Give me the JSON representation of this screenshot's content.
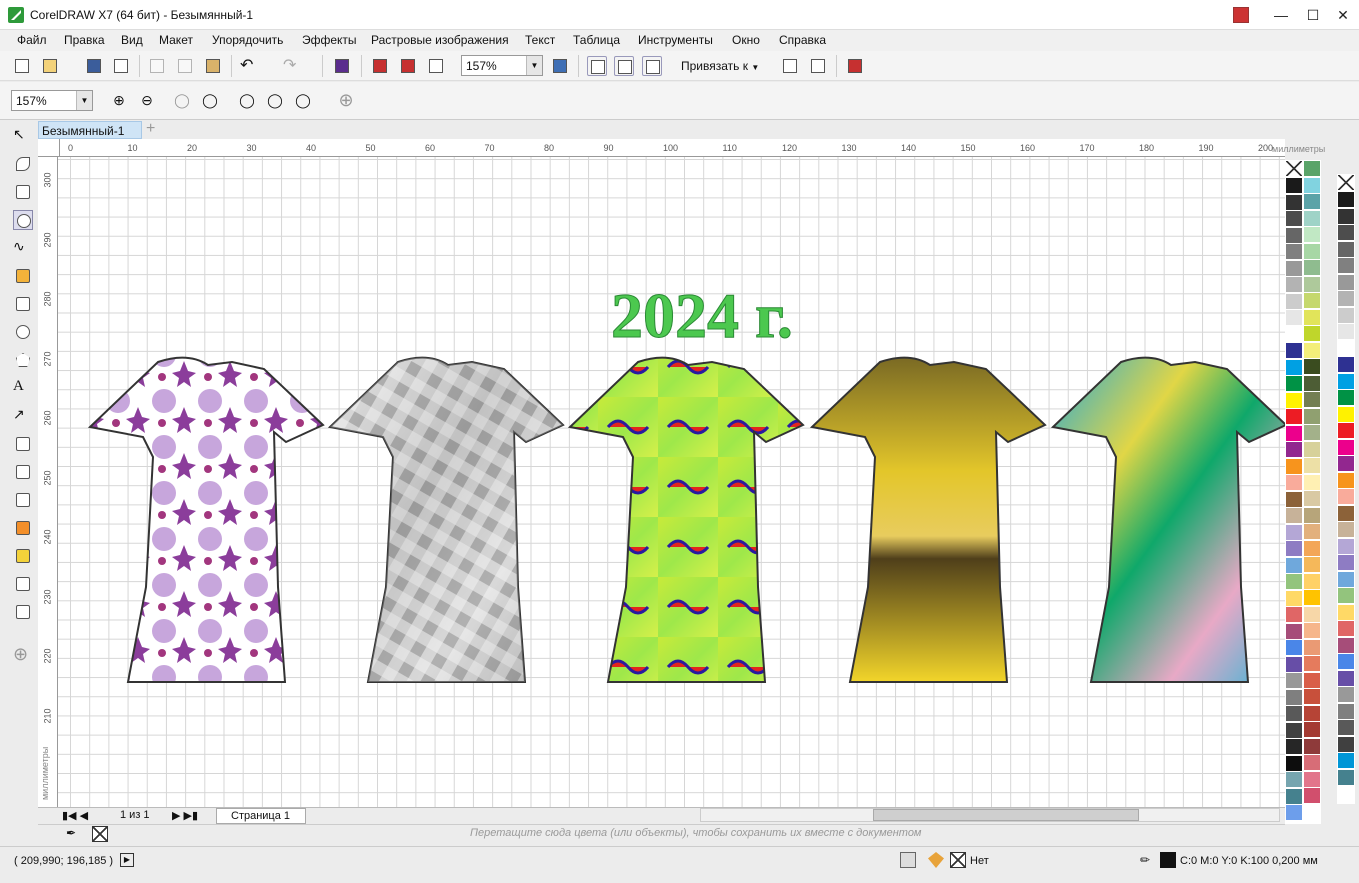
{
  "window": {
    "title": "CorelDRAW X7 (64 бит) - Безымянный-1",
    "min_icon": "minimize-icon",
    "max_icon": "maximize-icon",
    "close_icon": "close-icon"
  },
  "menu": [
    "Файл",
    "Правка",
    "Вид",
    "Макет",
    "Упорядочить",
    "Эффекты",
    "Растровые изображения",
    "Текст",
    "Таблица",
    "Инструменты",
    "Окно",
    "Справка"
  ],
  "toolbar": {
    "zoom_value": "157%",
    "snap_label": "Привязать к",
    "snap_arrow": "▼"
  },
  "toolbar2": {
    "zoom_value": "157%"
  },
  "doc": {
    "tab_label": "Безымянный-1",
    "tab_add": "+",
    "units": "миллиметры"
  },
  "rulers": {
    "h_ticks": [
      "0",
      "10",
      "20",
      "30",
      "40",
      "50",
      "60",
      "70",
      "80",
      "90",
      "100",
      "110",
      "120",
      "130",
      "140",
      "150",
      "160",
      "170",
      "180",
      "190",
      "200"
    ],
    "v_ticks": [
      "300",
      "290",
      "280",
      "270",
      "260",
      "250",
      "240",
      "230",
      "220",
      "210"
    ],
    "v_unit": "миллиметры"
  },
  "canvas": {
    "headline": "2024 г.",
    "headline_color": "#4cc84f",
    "dresses": [
      {
        "name": "dress-1",
        "style": "purple-star-print",
        "base": "#ffffff",
        "accent": "#8b3d9b"
      },
      {
        "name": "dress-2",
        "style": "grey-argyle",
        "base": "#cfcfcf",
        "accent": "#555555"
      },
      {
        "name": "dress-3",
        "style": "green-fractal",
        "base": "#c8ea3a",
        "accent": "#e2261d"
      },
      {
        "name": "dress-4",
        "style": "yellow-gradient",
        "base": "#e2c72a",
        "accent": "#6b5a20"
      },
      {
        "name": "dress-5",
        "style": "pastel-watercolor",
        "base": "#27a9d6",
        "accent": "#e1d646"
      }
    ]
  },
  "pager": {
    "count": "1 из 1",
    "page_tab": "Страница 1"
  },
  "dropzone": {
    "text": "Перетащите сюда цвета (или объекты), чтобы сохранить их вместе с документом"
  },
  "status": {
    "coords": "( 209,990; 196,185 )",
    "fill": "Нет",
    "outline": "C:0 M:0 Y:0 K:100  0,200 мм"
  },
  "palette": {
    "col1": [
      "#1a1a1a",
      "#333333",
      "#4d4d4d",
      "#666666",
      "#808080",
      "#999999",
      "#b3b3b3",
      "#cccccc",
      "#e6e6e6",
      "#ffffff",
      "#2e3192",
      "#00a0e3",
      "#009245",
      "#fff200",
      "#ed1c24",
      "#ec008c",
      "#92278f",
      "#f7941d",
      "#f9ab9b",
      "#8c6239",
      "#c7b299",
      "#b4a7d6",
      "#8e7cc3",
      "#6fa8dc",
      "#93c47d",
      "#ffd966",
      "#e06666",
      "#a64d79",
      "#4a86e8",
      "#674ea7",
      "#999999",
      "#7f7f7f",
      "#595959",
      "#404040",
      "#262626",
      "#0d0d0d",
      "#76a5af",
      "#45818e",
      "#6d9eeb",
      "#c27ba0"
    ],
    "col2": [
      "#5aa469",
      "#81d3e0",
      "#5ba3a8",
      "#9fd3c7",
      "#c1e8c4",
      "#a7d7a5",
      "#8fbc8f",
      "#aec99b",
      "#c5d86d",
      "#e1e45a",
      "#bfd62b",
      "#f3ee7a",
      "#3a4c1f",
      "#4d5d35",
      "#737f52",
      "#90a070",
      "#a3b18a",
      "#d7d19a",
      "#ede0a6",
      "#fff0b3",
      "#d9c9a3",
      "#b7a57a",
      "#e2b07d",
      "#f3a658",
      "#f5b85a",
      "#ffd166",
      "#ffc300",
      "#f7d7a8",
      "#f6b68b",
      "#ea9a74",
      "#e57b5d",
      "#d95e49",
      "#c8503b",
      "#b64436",
      "#a43a32",
      "#8e3a3a",
      "#d76d77",
      "#e2758b",
      "#d14f6d",
      "#e5163d"
    ],
    "col3": [
      "#ff6f61",
      "#f08a8a",
      "#e69aa6",
      "#d8a0b5",
      "#c68db0",
      "#b55d99",
      "#a34383",
      "#d99ac5",
      "#e7b3d6",
      "#f1c7e3",
      "#b068a8",
      "#a0529c",
      "#8e3d92",
      "#7b2f86",
      "#663399",
      "#59337a",
      "#4a2c6b",
      "#3b2559",
      "#2e1f48",
      "#21183a",
      "#c59be0",
      "#b27fd1",
      "#9c64bf",
      "#8549ac",
      "#6f3198",
      "#000000",
      "#7a7a7a",
      "#ffffff"
    ],
    "col4": [
      "#1a1a1a",
      "#333333",
      "#4d4d4d",
      "#666666",
      "#808080",
      "#999999",
      "#b3b3b3",
      "#cccccc",
      "#e6e6e6",
      "#ffffff",
      "#2e3192",
      "#00a0e3",
      "#009245",
      "#fff200",
      "#ed1c24",
      "#ec008c",
      "#92278f",
      "#f7941d",
      "#f9ab9b",
      "#8c6239",
      "#c7b299",
      "#b4a7d6",
      "#8e7cc3",
      "#6fa8dc",
      "#93c47d",
      "#ffd966",
      "#e06666",
      "#a64d79",
      "#4a86e8",
      "#674ea7",
      "#999999",
      "#7f7f7f",
      "#595959",
      "#404040",
      "#0096d6",
      "#45818e"
    ]
  }
}
